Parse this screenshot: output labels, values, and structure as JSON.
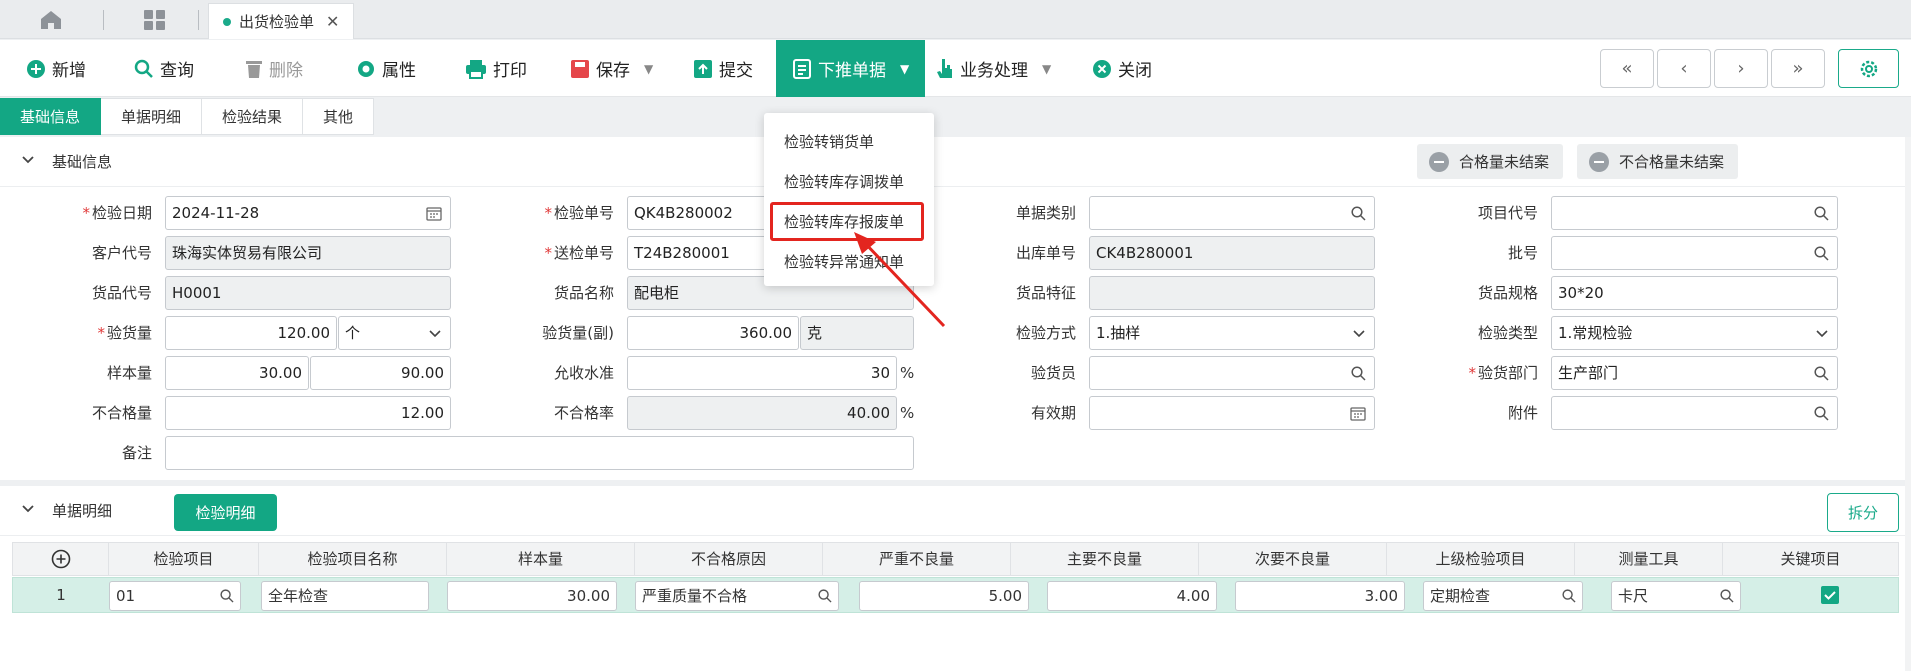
{
  "tabs": {
    "doc_tab": "出货检验单"
  },
  "toolbar": {
    "add": "新增",
    "query": "查询",
    "delete": "删除",
    "props": "属性",
    "print": "打印",
    "save": "保存",
    "submit": "提交",
    "push": "下推单据",
    "business": "业务处理",
    "close": "关闭",
    "nav": [
      "«",
      "‹",
      "›",
      "»"
    ]
  },
  "subtabs": [
    "基础信息",
    "单据明细",
    "检验结果",
    "其他"
  ],
  "basic": {
    "section_title": "基础信息",
    "btn_pass_unclosed": "合格量未结案",
    "btn_fail_unclosed": "不合格量未结案",
    "labels": {
      "inspect_date": "检验日期",
      "customer_code": "客户代号",
      "item_code": "货品代号",
      "inspect_qty": "验货量",
      "sample_qty": "样本量",
      "fail_qty": "不合格量",
      "remark": "备注",
      "inspect_no": "检验单号",
      "send_no": "送检单号",
      "item_name": "货品名称",
      "inspect_qty2": "验货量(副)",
      "accept_level": "允收水准",
      "fail_rate": "不合格率",
      "doc_type": "单据类别",
      "out_no": "出库单号",
      "item_feature": "货品特征",
      "inspect_method": "检验方式",
      "inspector": "验货员",
      "expiry": "有效期",
      "project_code": "项目代号",
      "batch_no": "批号",
      "item_spec": "货品规格",
      "inspect_type": "检验类型",
      "inspect_dept": "验货部门",
      "attachment": "附件"
    },
    "values": {
      "inspect_date": "2024-11-28",
      "customer_code": "珠海实体贸易有限公司",
      "item_code": "H0001",
      "inspect_qty": "120.00",
      "unit": "个",
      "sample_qty": "30.00",
      "sample_qty2": "90.00",
      "fail_qty": "12.00",
      "inspect_no": "QK4B280002",
      "send_no": "T24B280001",
      "item_name": "配电柜",
      "inspect_qty2": "360.00",
      "unit2": "克",
      "accept_level": "30",
      "fail_rate": "40.00",
      "pct": "%",
      "out_no": "CK4B280001",
      "inspect_method": "1.抽样",
      "item_spec": "30*20",
      "inspect_type": "1.常规检验",
      "inspect_dept": "生产部门"
    }
  },
  "dropdown": {
    "items": [
      "检验转销货单",
      "检验转库存调拨单",
      "检验转库存报废单",
      "检验转异常通知单"
    ]
  },
  "detail": {
    "section_title": "单据明细",
    "tab": "检验明细",
    "split": "拆分",
    "columns": [
      "检验项目",
      "检验项目名称",
      "样本量",
      "不合格原因",
      "严重不良量",
      "主要不良量",
      "次要不良量",
      "上级检验项目",
      "测量工具",
      "关键项目"
    ],
    "row": {
      "num": "1",
      "item": "01",
      "item_name": "全年检查",
      "sample": "30.00",
      "reason": "严重质量不合格",
      "severe": "5.00",
      "major": "4.00",
      "minor": "3.00",
      "parent": "定期检查",
      "tool": "卡尺",
      "key": true
    }
  },
  "colors": {
    "accent": "#13a784",
    "highlight": "#e3251f"
  }
}
